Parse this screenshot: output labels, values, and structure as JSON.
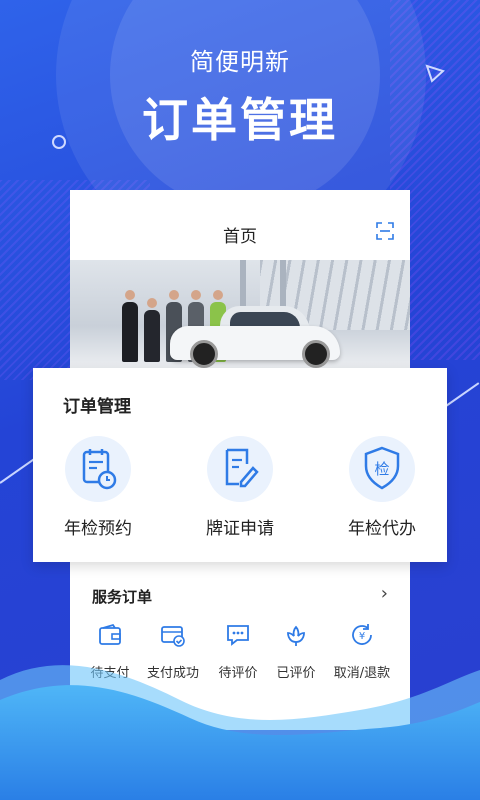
{
  "hero": {
    "subtitle": "简便明新",
    "title": "订单管理"
  },
  "phone": {
    "home_title": "首页"
  },
  "order_card": {
    "title": "订单管理",
    "features": [
      {
        "label": "年检预约",
        "icon": "calendar-clock-icon"
      },
      {
        "label": "牌证申请",
        "icon": "document-edit-icon"
      },
      {
        "label": "年检代办",
        "icon": "shield-check-icon",
        "badge": "检"
      }
    ]
  },
  "service_orders": {
    "title": "服务订单",
    "items": [
      {
        "label": "待支付",
        "icon": "wallet-icon"
      },
      {
        "label": "支付成功",
        "icon": "payment-success-icon"
      },
      {
        "label": "待评价",
        "icon": "comment-icon"
      },
      {
        "label": "已评价",
        "icon": "flower-icon"
      },
      {
        "label": "取消/退款",
        "icon": "refund-icon"
      }
    ]
  },
  "colors": {
    "background": "#2a49d8",
    "accent_blue": "#2f7be6",
    "icon_bg": "#eaf2fd",
    "wave": "#3aa0f0"
  }
}
